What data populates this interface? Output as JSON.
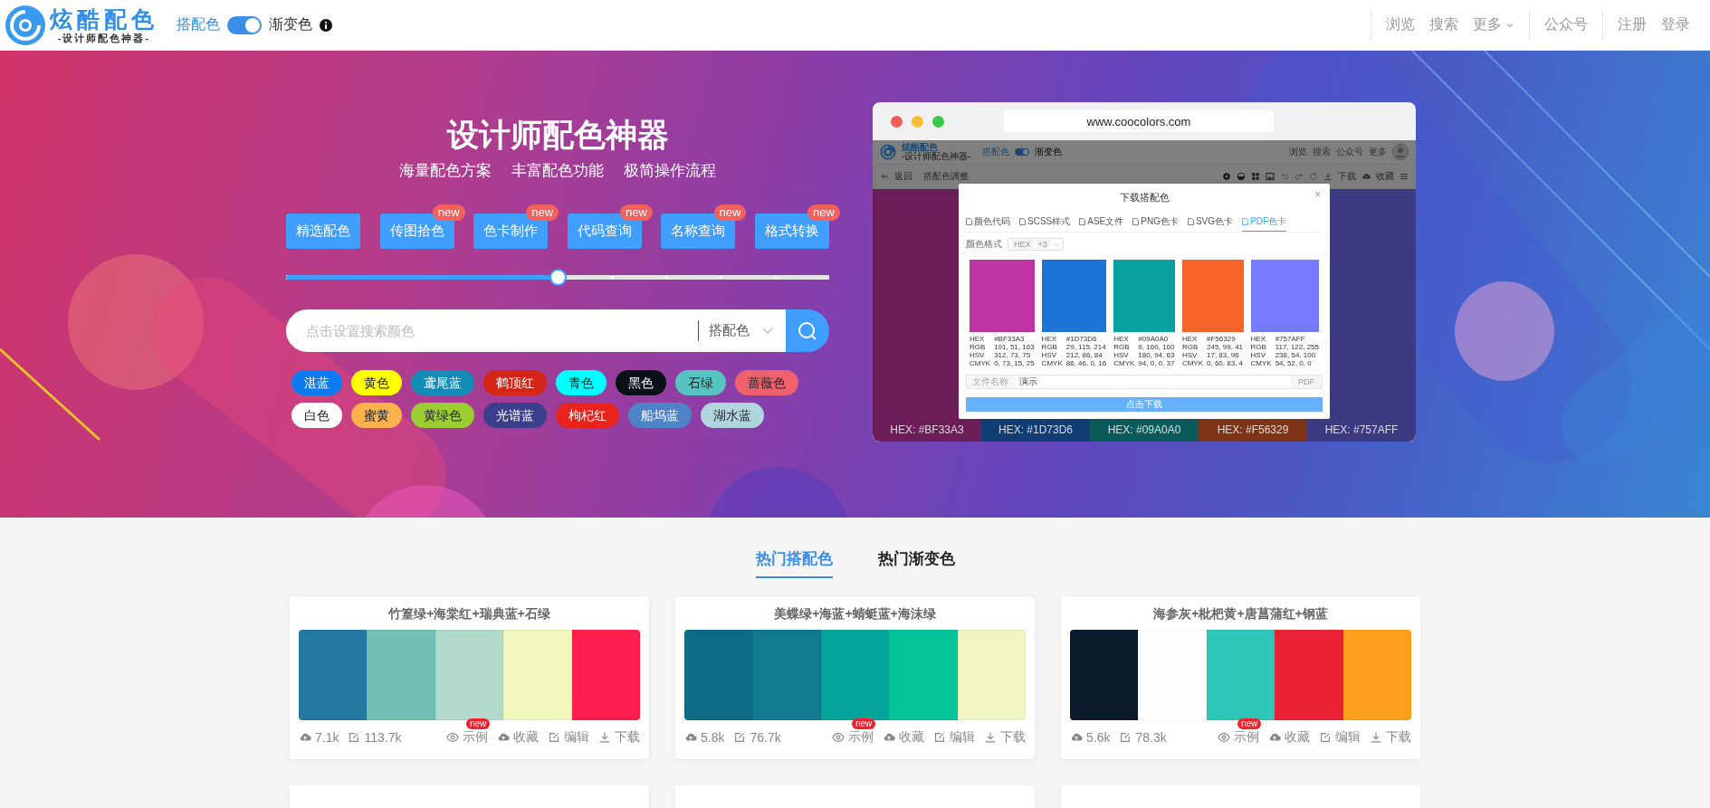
{
  "header": {
    "logo": {
      "title": "炫酷配色",
      "subtitle": "-设计师配色神器-"
    },
    "mode_toggle": {
      "left_label": "搭配色",
      "right_label": "渐变色",
      "on": true
    },
    "nav_groups": [
      {
        "items": [
          {
            "label": "浏览",
            "dropdown": false
          },
          {
            "label": "搜索",
            "dropdown": false
          },
          {
            "label": "更多",
            "dropdown": true
          }
        ]
      },
      {
        "items": [
          {
            "label": "公众号",
            "dropdown": false
          }
        ]
      },
      {
        "items": [
          {
            "label": "注册",
            "dropdown": false
          },
          {
            "label": "登录",
            "dropdown": false
          }
        ]
      }
    ]
  },
  "hero": {
    "title": "设计师配色神器",
    "taglines": [
      "海量配色方案",
      "丰富配色功能",
      "极简操作流程"
    ],
    "tools": [
      {
        "label": "精选配色"
      },
      {
        "label": "传图拾色",
        "badge": "new"
      },
      {
        "label": "色卡制作",
        "badge": "new"
      },
      {
        "label": "代码查询",
        "badge": "new"
      },
      {
        "label": "名称查询",
        "badge": "new"
      },
      {
        "label": "格式转换",
        "badge": "new"
      }
    ],
    "slider": {
      "level": 0.5
    },
    "search": {
      "placeholder": "点击设置搜索颜色",
      "type": "搭配色"
    },
    "color_chips": [
      [
        {
          "label": "湛蓝",
          "color": "#0c7bf0"
        },
        {
          "label": "黄色",
          "color": "#ffff00"
        },
        {
          "label": "鸢尾蓝",
          "color": "#158bb8"
        },
        {
          "label": "鹤顶红",
          "color": "#d42517"
        },
        {
          "label": "青色",
          "color": "#00ffff"
        },
        {
          "label": "黑色",
          "color": "#0b0f17"
        },
        {
          "label": "石绿",
          "color": "#57c3c2"
        },
        {
          "label": "蔷薇色",
          "color": "#f0616e"
        }
      ],
      [
        {
          "label": "白色",
          "color": "#ffffff"
        },
        {
          "label": "蜜黄",
          "color": "#fbb14c"
        },
        {
          "label": "黄绿色",
          "color": "#9acd32"
        },
        {
          "label": "光谱蓝",
          "color": "#3b3e8c"
        },
        {
          "label": "枸杞红",
          "color": "#e8231e"
        },
        {
          "label": "船坞蓝",
          "color": "#4e83c8"
        },
        {
          "label": "湖水蓝",
          "color": "#b0d5df"
        }
      ]
    ]
  },
  "showcase": {
    "url": "www.coocolors.com",
    "app_header": {
      "logo_title": "炫酷配色",
      "logo_subtitle": "-设计师配色神器-",
      "toggle_left": "搭配色",
      "toggle_right": "渐变色",
      "toggle_on": true,
      "nav": [
        "浏览",
        "搜索",
        "公众号",
        "更多"
      ]
    },
    "toolbar": {
      "back": "返回",
      "crumb": "搭配色调整",
      "actions": [
        "下载",
        "收藏"
      ]
    },
    "columns": [
      {
        "color": "#6b1d57",
        "label": "HEX: #BF33A3"
      },
      {
        "color": "#113e72",
        "label": "HEX: #1D73D6"
      },
      {
        "color": "#0a5a5a",
        "label": "HEX: #09A0A0"
      },
      {
        "color": "#7d3416",
        "label": "HEX: #F56329"
      },
      {
        "color": "#3c3a80",
        "label": "HEX: #757AFF"
      }
    ],
    "dialog": {
      "title": "下载搭配色",
      "close": "×",
      "tabs": [
        {
          "label": "颜色代码",
          "selected": false
        },
        {
          "label": "SCSS样式",
          "selected": false
        },
        {
          "label": "ASE文件",
          "selected": false
        },
        {
          "label": "PNG色卡",
          "selected": false
        },
        {
          "label": "SVG色卡",
          "selected": false
        },
        {
          "label": "PDF色卡",
          "selected": true
        }
      ],
      "format_label": "颜色格式",
      "format_value": "HEX",
      "format_extra": "+3",
      "swatches": [
        {
          "color": "#bf33a3",
          "rows": [
            [
              "HEX",
              "#BF33A3"
            ],
            [
              "RGB",
              "191, 51, 163"
            ],
            [
              "HSV",
              "312, 73, 75"
            ],
            [
              "CMYK",
              "0, 73, 15, 25"
            ]
          ]
        },
        {
          "color": "#1d73d6",
          "rows": [
            [
              "HEX",
              "#1D73D6"
            ],
            [
              "RGB",
              "29, 115, 214"
            ],
            [
              "HSV",
              "212, 86, 84"
            ],
            [
              "CMYK",
              "86, 46, 0, 16"
            ]
          ]
        },
        {
          "color": "#09a0a0",
          "rows": [
            [
              "HEX",
              "#09A0A0"
            ],
            [
              "RGB",
              "9, 160, 160"
            ],
            [
              "HSV",
              "180, 94, 63"
            ],
            [
              "CMYK",
              "94, 0, 0, 37"
            ]
          ]
        },
        {
          "color": "#f56329",
          "rows": [
            [
              "HEX",
              "#F56329"
            ],
            [
              "RGB",
              "245, 99, 41"
            ],
            [
              "HSV",
              "17, 83, 96"
            ],
            [
              "CMYK",
              "0, 60, 83, 4"
            ]
          ]
        },
        {
          "color": "#757aff",
          "rows": [
            [
              "HEX",
              "#757AFF"
            ],
            [
              "RGB",
              "117, 122, 255"
            ],
            [
              "HSV",
              "238, 54, 100"
            ],
            [
              "CMYK",
              "54, 52, 0, 0"
            ]
          ]
        }
      ],
      "filename_label": "文件名称",
      "filename_value": "演示",
      "file_ext": "PDF",
      "download_button": "点击下载"
    }
  },
  "gallery": {
    "tabs": [
      {
        "label": "热门搭配色",
        "selected": true
      },
      {
        "label": "热门渐变色",
        "selected": false
      }
    ],
    "cards": [
      {
        "title": "竹篁绿+海棠红+瑞典蓝+石绿",
        "swatches": [
          {
            "color": "#2379a0"
          },
          {
            "color": "#70c0b3"
          },
          {
            "color": "#b2dacb"
          },
          {
            "color": "#f1f7bd"
          },
          {
            "color": "#ff1e4f"
          }
        ],
        "stats": [
          "7.1k",
          "113.7k"
        ],
        "actions": [
          {
            "label": "示例",
            "badge": "new"
          },
          {
            "label": "收藏"
          },
          {
            "label": "编辑"
          },
          {
            "label": "下载"
          }
        ]
      },
      {
        "title": "美蝶绿+海蓝+蜻蜓蓝+海沫绿",
        "swatches": [
          {
            "color": "#0f6c87"
          },
          {
            "color": "#117a8f"
          },
          {
            "color": "#05a49a"
          },
          {
            "color": "#04c49a"
          },
          {
            "color": "#f0f5c2"
          }
        ],
        "stats": [
          "5.8k",
          "76.7k"
        ],
        "actions": [
          {
            "label": "示例",
            "badge": "new"
          },
          {
            "label": "收藏"
          },
          {
            "label": "编辑"
          },
          {
            "label": "下载"
          }
        ]
      },
      {
        "title": "海参灰+枇杷黄+唐菖蒲红+钢蓝",
        "swatches": [
          {
            "color": "#0b1b2c"
          },
          {
            "color": "#fdfefd"
          },
          {
            "color": "#2ec6b8"
          },
          {
            "color": "#ea2236"
          },
          {
            "color": "#fe9f1e"
          }
        ],
        "stats": [
          "5.6k",
          "78.3k"
        ],
        "actions": [
          {
            "label": "示例",
            "badge": "new"
          },
          {
            "label": "收藏"
          },
          {
            "label": "编辑"
          },
          {
            "label": "下载"
          }
        ]
      }
    ]
  }
}
